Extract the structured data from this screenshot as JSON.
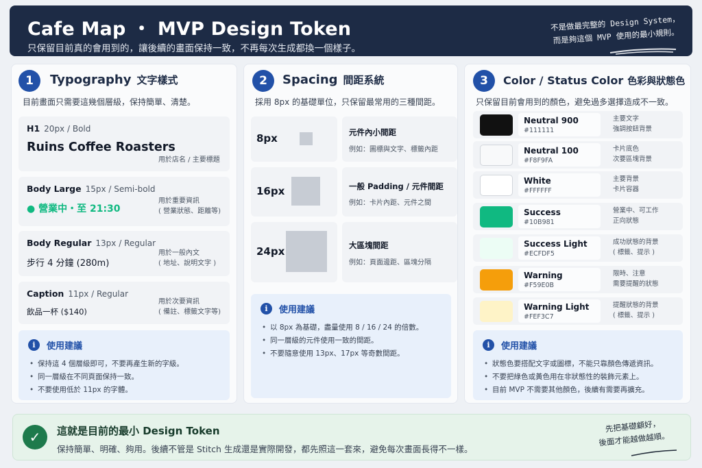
{
  "header": {
    "title": "Cafe Map ・ MVP Design Token",
    "subtitle": "只保留目前真的會用到的，讓後續的畫面保持一致，不再每次生成都換一個樣子。",
    "note_line1": "不是做最完整的 Design System，",
    "note_line2": "而是夠這個 MVP 使用的最小規則。"
  },
  "typography": {
    "number": "1",
    "title": "Typography",
    "title_zh": "文字樣式",
    "desc": "目前畫面只需要這幾個層級，保持簡單、清楚。",
    "items": [
      {
        "name": "H1",
        "spec": "20px / Bold",
        "sample": "Ruins Coffee Roasters",
        "note1": "用於店名 / 主要標題",
        "note2": ""
      },
      {
        "name": "Body Large",
        "spec": "15px / Semi-bold",
        "sample": "● 營業中・至 21:30",
        "note1": "用於重要資訊",
        "note2": "( 營業狀態、距離等)"
      },
      {
        "name": "Body Regular",
        "spec": "13px / Regular",
        "sample": "步行 4 分鐘 (280m)",
        "note1": "用於一般內文",
        "note2": "( 地址、說明文字 )"
      },
      {
        "name": "Caption",
        "spec": "11px / Regular",
        "sample": "飲品一杯 ($140)",
        "note1": "用於次要資訊",
        "note2": "( 備註、標籤文字等)"
      }
    ],
    "tips_title": "使用建議",
    "tips": [
      "保持這 4 個層級即可，不要再產生新的字級。",
      "同一層級在不同頁面保持一致。",
      "不要使用低於 11px 的字體。"
    ]
  },
  "spacing": {
    "number": "2",
    "title": "Spacing",
    "title_zh": "間距系統",
    "desc": "採用 8px 的基礎單位，只保留最常用的三種間距。",
    "items": [
      {
        "label": "8px",
        "size": 8,
        "name": "元件內小間距",
        "example": "例如：圖標與文字、標籤內距"
      },
      {
        "label": "16px",
        "size": 16,
        "name": "一般 Padding / 元件間距",
        "example": "例如：卡片內距、元件之間"
      },
      {
        "label": "24px",
        "size": 24,
        "name": "大區塊間距",
        "example": "例如：頁面邊距、區塊分隔"
      }
    ],
    "tips_title": "使用建議",
    "tips": [
      "以 8px 為基礎，盡量使用 8 / 16 / 24 的倍數。",
      "同一層級的元件使用一致的間距。",
      "不要隨意使用 13px、17px 等奇數間距。"
    ]
  },
  "colors": {
    "number": "3",
    "title": "Color / Status Color",
    "title_zh": "色彩與狀態色",
    "desc": "只保留目前會用到的顏色，避免過多選擇造成不一致。",
    "items": [
      {
        "name": "Neutral 900",
        "hex": "#111111",
        "use1": "主要文字",
        "use2": "強調按鈕背景"
      },
      {
        "name": "Neutral 100",
        "hex": "#F8F9FA",
        "use1": "卡片底色",
        "use2": "次要區塊背景"
      },
      {
        "name": "White",
        "hex": "#FFFFFF",
        "use1": "主要背景",
        "use2": "卡片容器"
      },
      {
        "name": "Success",
        "hex": "#10B981",
        "use1": "營業中、可工作",
        "use2": "正向狀態"
      },
      {
        "name": "Success Light",
        "hex": "#ECFDF5",
        "use1": "成功狀態的背景",
        "use2": "( 標籤、提示 )"
      },
      {
        "name": "Warning",
        "hex": "#F59E0B",
        "use1": "限時、注意",
        "use2": "需要提醒的狀態"
      },
      {
        "name": "Warning Light",
        "hex": "#FEF3C7",
        "use1": "提醒狀態的背景",
        "use2": "( 標籤、提示 )"
      }
    ],
    "tips_title": "使用建議",
    "tips": [
      "狀態色要搭配文字或圖標，不能只靠顏色傳遞資訊。",
      "不要把綠色或黃色用在非狀態性的裝飾元素上。",
      "目前 MVP 不需要其他顏色，後續有需要再擴充。"
    ]
  },
  "footer": {
    "title": "這就是目前的最小 Design Token",
    "desc": "保持簡單、明確、夠用。後續不管是 Stitch 生成還是實際開發，都先照這一套來，避免每次畫面長得不一樣。",
    "note_line1": "先把基礎顧好，",
    "note_line2": "後面才能越做越順。"
  }
}
